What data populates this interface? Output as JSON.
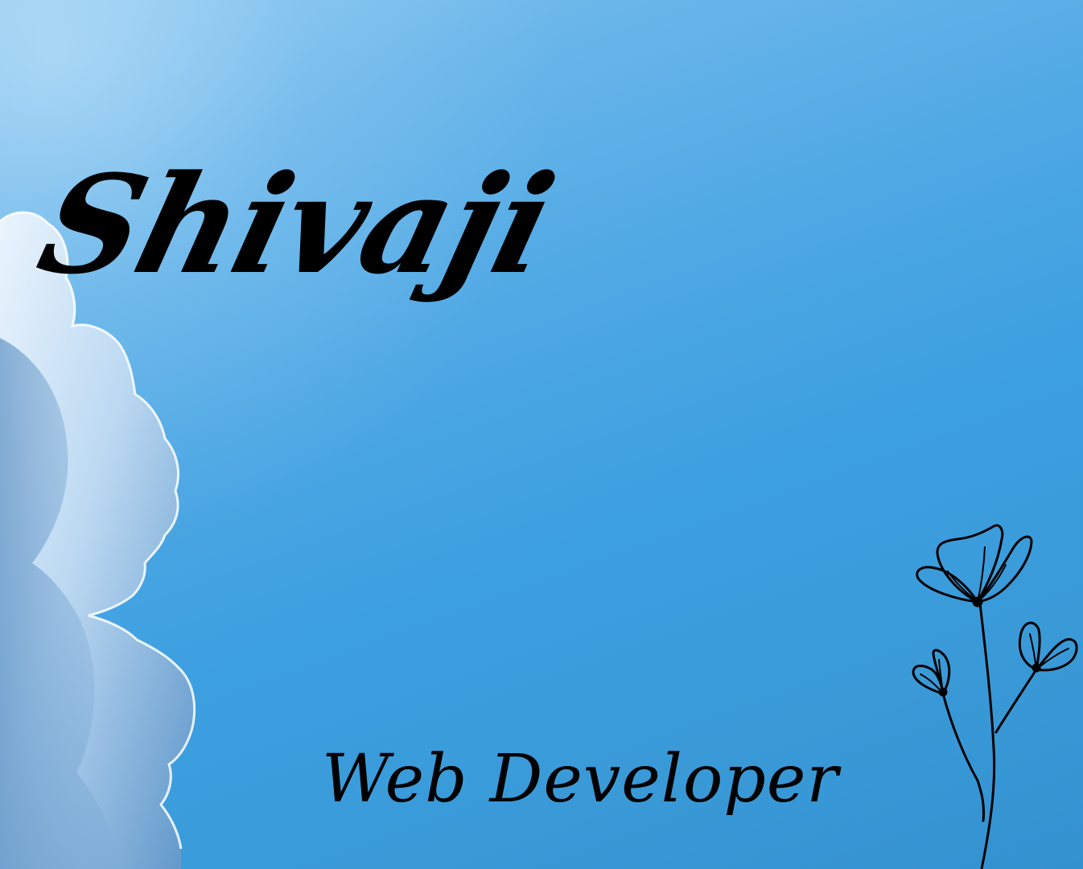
{
  "background": {
    "sky_color": "#3c9fe0",
    "cloud_color": "#cfe3f5"
  },
  "title": "Shivaji",
  "subtitle": "Web Developer",
  "decoration": {
    "flower_icon": "flower-line-art-icon",
    "ink_color": "#000000"
  }
}
